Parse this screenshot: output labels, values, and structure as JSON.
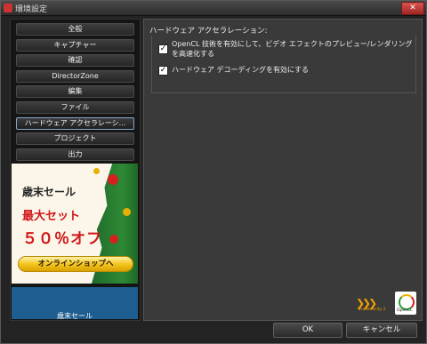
{
  "window": {
    "title": "環境設定",
    "close_label": "✕"
  },
  "sidebar": {
    "items": [
      {
        "label": "全般"
      },
      {
        "label": "キャプチャー"
      },
      {
        "label": "確認"
      },
      {
        "label": "DirectorZone"
      },
      {
        "label": "編集"
      },
      {
        "label": "ファイル"
      },
      {
        "label": "ハードウェア アクセラレーシ..."
      },
      {
        "label": "プロジェクト"
      },
      {
        "label": "出力"
      }
    ],
    "active_index": 6
  },
  "ad": {
    "line1": "歳末セール",
    "line2": "最大セット",
    "line3": "５０％オフ",
    "button": "オンラインショップへ"
  },
  "ad2": {
    "text": "歳末セール"
  },
  "panel": {
    "heading": "ハードウェア アクセラレーション:",
    "options": [
      {
        "label_line1": "OpenCL 技術を有効にして、ビデオ エフェクトのプレビュー/レンダリング",
        "label_line2": "を高速化する",
        "checked": true
      },
      {
        "label_line1": "ハードウェア デコーディングを有効にする",
        "checked": true
      }
    ],
    "logo_truevelocity": "TrueVelocity 2",
    "logo_opencl": "OpenCL"
  },
  "footer": {
    "ok": "OK",
    "cancel": "キャンセル"
  },
  "colors": {
    "accent_border": "#8aa6c8",
    "sale_red": "#d01818",
    "button_gold": "#f3c620"
  }
}
